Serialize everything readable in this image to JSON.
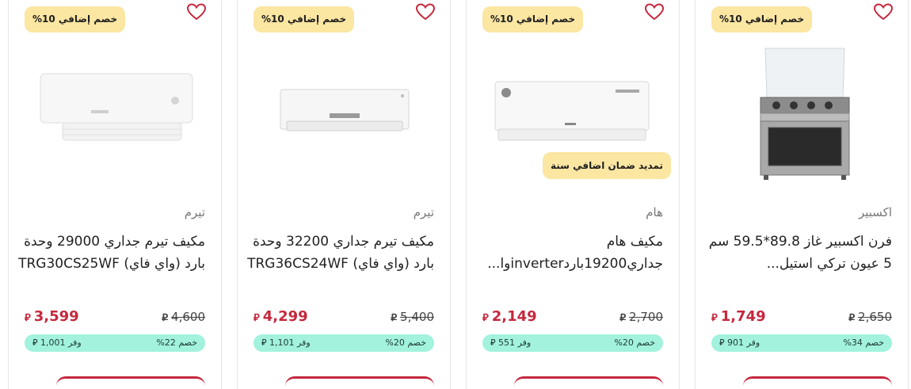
{
  "currency_symbol": "⃁",
  "products": [
    {
      "badge": "خصم إضافي 10%",
      "warranty": "",
      "brand": "تيرم",
      "title": "مكيف تيرم جداري 29000 وحدة بارد (واي فاي) TRG30CS25WF",
      "price_now": "3,599",
      "price_old": "4,600",
      "discount": "خصم 22%",
      "save_label": "وفر",
      "save_amount": "1,001",
      "image_icon": "split-ac-unit-image",
      "heart_icon": "heart-outline-icon"
    },
    {
      "badge": "خصم إضافي 10%",
      "warranty": "",
      "brand": "تيرم",
      "title": "مكيف تيرم جداري 32200 وحدة بارد (واي فاي) TRG36CS24WF",
      "price_now": "4,299",
      "price_old": "5,400",
      "discount": "خصم 20%",
      "save_label": "وفر",
      "save_amount": "1,101",
      "image_icon": "split-ac-unit-image",
      "heart_icon": "heart-outline-icon"
    },
    {
      "badge": "خصم إضافي 10%",
      "warranty": "تمديد ضمان اضافي سنة",
      "brand": "هام",
      "title": "مكيف هام جداري19200باردinverterوا...",
      "price_now": "2,149",
      "price_old": "2,700",
      "discount": "خصم 20%",
      "save_label": "وفر",
      "save_amount": "551",
      "image_icon": "split-ac-unit-image",
      "heart_icon": "heart-outline-icon"
    },
    {
      "badge": "خصم إضافي 10%",
      "warranty": "",
      "brand": "اكسبير",
      "title": "فرن اكسبير غاز 89.8*59.5 سم 5 عيون تركي استيل...",
      "price_now": "1,749",
      "price_old": "2,650",
      "discount": "خصم 34%",
      "save_label": "وفر",
      "save_amount": "901",
      "image_icon": "gas-oven-image",
      "heart_icon": "heart-outline-icon"
    }
  ],
  "colors": {
    "badge_bg": "#fbe6a2",
    "price_red": "#c5283d",
    "savings_bg": "#a2f2dd",
    "heart": "#c5283d"
  }
}
